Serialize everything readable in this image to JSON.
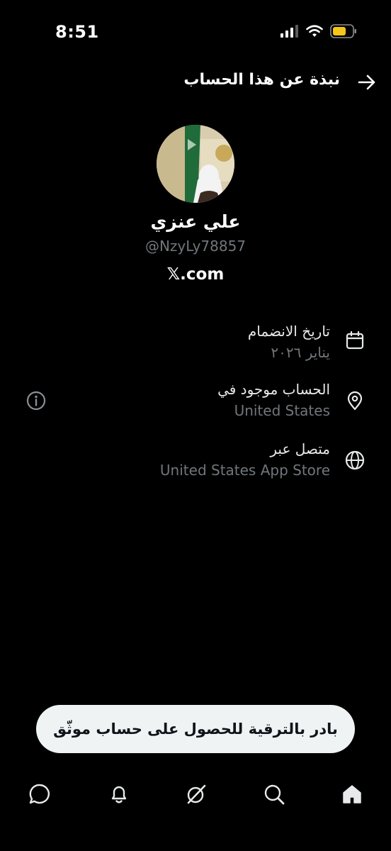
{
  "status_bar": {
    "time": "8:51",
    "battery_color": "#f5c518"
  },
  "header": {
    "title": "نبذة عن هذا الحساب",
    "back_icon": "arrow-right-icon"
  },
  "profile": {
    "display_name": "علي عنزي",
    "handle": "@NzyLy78857",
    "website": "𝕏.com",
    "avatar_icon": "avatar-photo"
  },
  "info": {
    "joined": {
      "label": "تاريخ الانضمام",
      "value": "يناير ٢٠٢٦",
      "icon": "calendar-icon"
    },
    "location": {
      "label": "الحساب موجود في",
      "value": "United States",
      "icon": "location-pin-icon",
      "info_icon": "info-circle-icon"
    },
    "connected": {
      "label": "متصل عبر",
      "value": "United States App Store",
      "icon": "globe-icon"
    }
  },
  "upgrade": {
    "label": "بادر بالترقية للحصول على حساب موثّق"
  },
  "tabs": [
    {
      "icon": "chat-icon"
    },
    {
      "icon": "bell-icon"
    },
    {
      "icon": "grok-icon"
    },
    {
      "icon": "search-icon"
    },
    {
      "icon": "home-icon",
      "active": true
    }
  ],
  "colors": {
    "background": "#000000",
    "text_primary": "#e7e9ea",
    "text_secondary": "#71767b",
    "pill": "#eff3f4"
  }
}
